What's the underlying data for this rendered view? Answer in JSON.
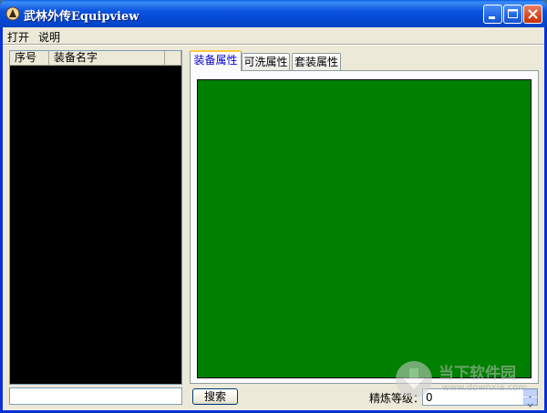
{
  "window": {
    "title": "武林外传Equipview",
    "colors": {
      "titlebar": "#0548d3",
      "panel": "#008000",
      "list_bg": "#000000",
      "close_btn": "#d9471f"
    },
    "icons": [
      "app-icon",
      "minimize-icon",
      "maximize-icon",
      "close-icon"
    ]
  },
  "menu": {
    "items": [
      "打开",
      "说明"
    ]
  },
  "list": {
    "columns": [
      "序号",
      "装备名字"
    ]
  },
  "tabs": [
    "装备属性",
    "可洗属性",
    "套装属性"
  ],
  "controls": {
    "search_button": "搜索",
    "refine_label": "精炼等级：",
    "refine_value": "0"
  },
  "watermark": {
    "name": "当下软件园",
    "url": "www.downxia.com"
  }
}
